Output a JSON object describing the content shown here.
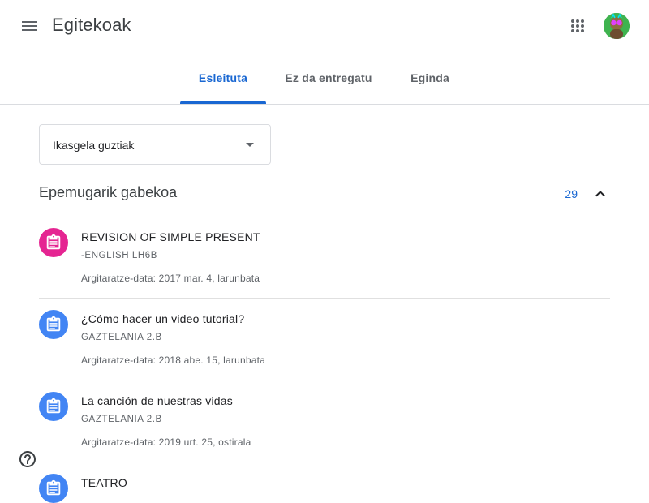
{
  "header": {
    "title": "Egitekoak",
    "menu_icon": "hamburger-menu-icon",
    "apps_icon": "apps-grid-icon",
    "avatar_icon": "user-avatar"
  },
  "tabs": [
    {
      "label": "Esleituta",
      "active": true
    },
    {
      "label": "Ez da entregatu",
      "active": false
    },
    {
      "label": "Eginda",
      "active": false
    }
  ],
  "filter": {
    "selected": "Ikasgela guztiak"
  },
  "section": {
    "title": "Epemugarik gabekoa",
    "count": "29"
  },
  "items": [
    {
      "title": "REVISION OF SIMPLE PRESENT",
      "class": "-ENGLISH LH6B",
      "date": "Argitaratze-data: 2017 mar. 4, larunbata",
      "color": "#e52592"
    },
    {
      "title": "¿Cómo hacer un video tutorial?",
      "class": "GAZTELANIA 2.B",
      "date": "Argitaratze-data: 2018 abe. 15, larunbata",
      "color": "#4285f4"
    },
    {
      "title": "La canción de nuestras vidas",
      "class": "GAZTELANIA 2.B",
      "date": "Argitaratze-data: 2019 urt. 25, ostirala",
      "color": "#4285f4"
    },
    {
      "title": "TEATRO",
      "class": "",
      "date": "",
      "color": "#4285f4"
    }
  ],
  "colors": {
    "accent": "#1967d2",
    "divider": "#e0e0e0"
  }
}
